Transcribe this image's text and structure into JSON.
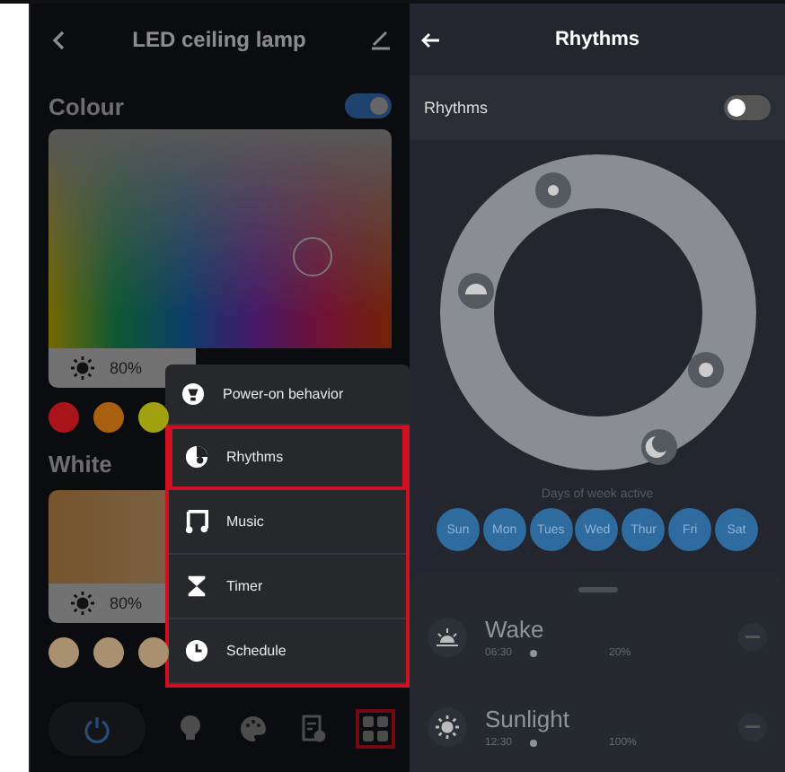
{
  "left_screen": {
    "title": "LED ceiling lamp",
    "colour": {
      "label": "Colour",
      "on": true,
      "brightness": "80%",
      "swatches": [
        {
          "color": "#a8141a"
        },
        {
          "color": "#a86010"
        },
        {
          "color": "#a0a010"
        }
      ]
    },
    "white": {
      "label": "White",
      "brightness": "80%",
      "swatches": [
        {
          "color": "#a89070"
        },
        {
          "color": "#a89070"
        },
        {
          "color": "#a89070"
        }
      ]
    },
    "nav": [
      {
        "kind": "power",
        "highlighted": false
      },
      {
        "kind": "bulb",
        "highlighted": false
      },
      {
        "kind": "palette",
        "highlighted": false
      },
      {
        "kind": "schedule",
        "highlighted": false
      },
      {
        "kind": "grid",
        "highlighted": true
      }
    ],
    "menu": [
      {
        "kind": "power",
        "label": "Power-on behavior",
        "highlighted": false
      },
      {
        "kind": "rhythm",
        "label": "Rhythms",
        "highlighted": true
      },
      {
        "kind": "music",
        "label": "Music",
        "highlighted": false
      },
      {
        "kind": "timer",
        "label": "Timer",
        "highlighted": false
      },
      {
        "kind": "clock",
        "label": "Schedule",
        "highlighted": false
      }
    ]
  },
  "right_screen": {
    "title": "Rhythms",
    "toggle": {
      "label": "Rhythms",
      "on": false
    },
    "days_label": "Days of week active",
    "days": [
      {
        "label": "Sun",
        "selected": true
      },
      {
        "label": "Mon",
        "selected": true
      },
      {
        "label": "Tues",
        "selected": true
      },
      {
        "label": "Wed",
        "selected": true
      },
      {
        "label": "Thur",
        "selected": true
      },
      {
        "label": "Fri",
        "selected": true
      },
      {
        "label": "Sat",
        "selected": true
      }
    ],
    "rhythms": [
      {
        "kind": "sunrise",
        "name": "Wake",
        "time": "06:30",
        "brightness": "20%"
      },
      {
        "kind": "sun",
        "name": "Sunlight",
        "time": "12:30",
        "brightness": "100%"
      }
    ]
  }
}
